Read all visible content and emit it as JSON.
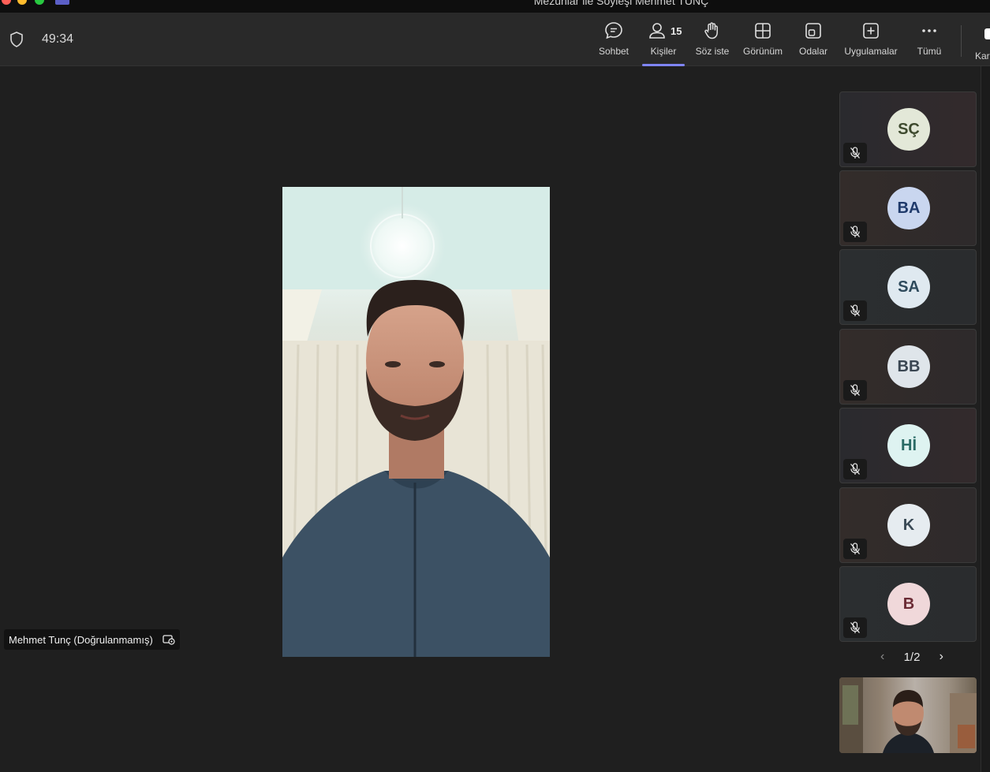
{
  "window": {
    "title": "Mezunlar ile Söyleşi Mehmet TUNÇ"
  },
  "toolbar": {
    "timer": "49:34",
    "chat_label": "Sohbet",
    "people_label": "Kişiler",
    "people_count": "15",
    "raise_hand_label": "Söz iste",
    "view_label": "Görünüm",
    "rooms_label": "Odalar",
    "apps_label": "Uygulamalar",
    "more_label": "Tümü",
    "camera_label": "Kar"
  },
  "stage": {
    "speaker_name": "Mehmet Tunç (Doğrulanmamış)"
  },
  "gallery": {
    "participants": [
      {
        "initials": "SÇ",
        "avatar_bg": "#e3e8d8",
        "avatar_fg": "#3e4a2e",
        "muted": true
      },
      {
        "initials": "BA",
        "avatar_bg": "#c9d6ef",
        "avatar_fg": "#1f3a6b",
        "muted": true
      },
      {
        "initials": "SA",
        "avatar_bg": "#dfe9f0",
        "avatar_fg": "#2e4a5c",
        "muted": true
      },
      {
        "initials": "BB",
        "avatar_bg": "#dfe5ea",
        "avatar_fg": "#3a4652",
        "muted": true
      },
      {
        "initials": "Hİ",
        "avatar_bg": "#def3f1",
        "avatar_fg": "#2a6b66",
        "muted": true
      },
      {
        "initials": "K",
        "avatar_bg": "#e6ecf0",
        "avatar_fg": "#3a4a56",
        "muted": true
      },
      {
        "initials": "B",
        "avatar_bg": "#f0d8da",
        "avatar_fg": "#6b2b35",
        "muted": true
      }
    ],
    "page_indicator": "1/2"
  },
  "colors": {
    "accent": "#7f85f5",
    "background": "#1f1f1f",
    "toolbar": "#292929"
  }
}
